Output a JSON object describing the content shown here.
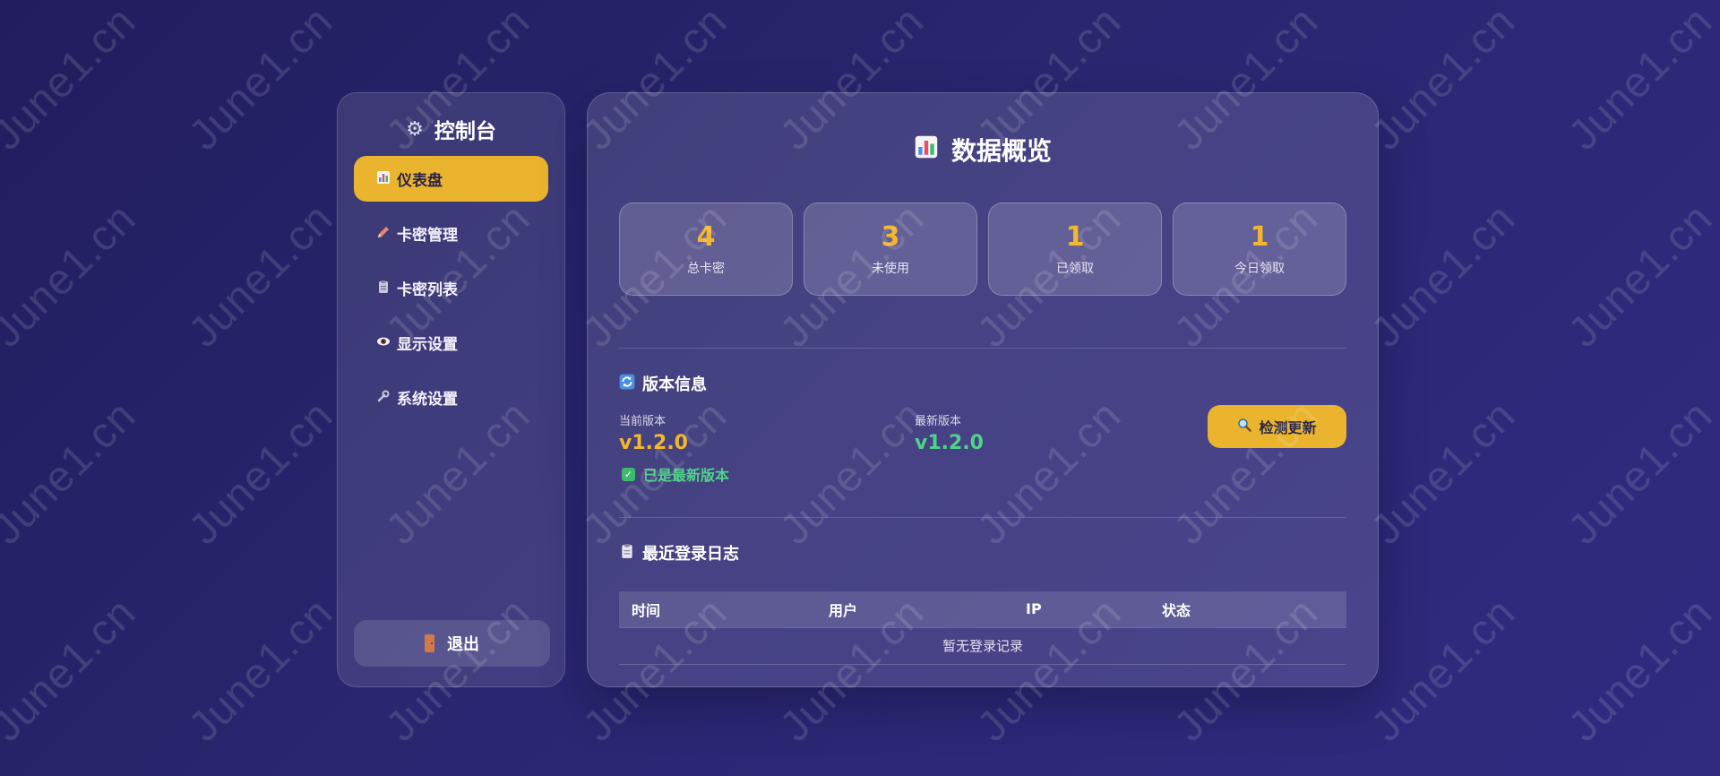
{
  "watermark": "June1.cn",
  "sidebar": {
    "title": "控制台",
    "title_icon": "gear-icon",
    "items": [
      {
        "id": "dashboard",
        "label": "仪表盘",
        "icon": "bar-chart-icon",
        "active": true
      },
      {
        "id": "card-management",
        "label": "卡密管理",
        "icon": "pencil-icon",
        "active": false
      },
      {
        "id": "card-list",
        "label": "卡密列表",
        "icon": "clipboard-icon",
        "active": false
      },
      {
        "id": "display-settings",
        "label": "显示设置",
        "icon": "eye-icon",
        "active": false
      },
      {
        "id": "system-settings",
        "label": "系统设置",
        "icon": "wrench-icon",
        "active": false
      }
    ],
    "logout_label": "退出",
    "logout_icon": "door-icon"
  },
  "main": {
    "title": "数据概览",
    "title_icon": "bar-chart-icon",
    "stats": [
      {
        "value": "4",
        "label": "总卡密"
      },
      {
        "value": "3",
        "label": "未使用"
      },
      {
        "value": "1",
        "label": "已领取"
      },
      {
        "value": "1",
        "label": "今日领取"
      }
    ],
    "version": {
      "title": "版本信息",
      "title_icon": "refresh-icon",
      "current_label": "当前版本",
      "current_value": "v1.2.0",
      "latest_label": "最新版本",
      "latest_value": "v1.2.0",
      "check_button_label": "检测更新",
      "check_button_icon": "magnifier-icon",
      "status_text": "已是最新版本",
      "status_icon": "check-box-icon"
    },
    "login_log": {
      "title": "最近登录日志",
      "title_icon": "clipboard-icon",
      "columns": [
        "时间",
        "用户",
        "IP",
        "状态"
      ],
      "empty_text": "暂无登录记录"
    }
  },
  "colors": {
    "accent": "#ebb42e",
    "stat_value": "#f3b72c",
    "current_version": "#f3b72c",
    "latest_version": "#4fd38a",
    "status_ok": "#4fd38a"
  }
}
